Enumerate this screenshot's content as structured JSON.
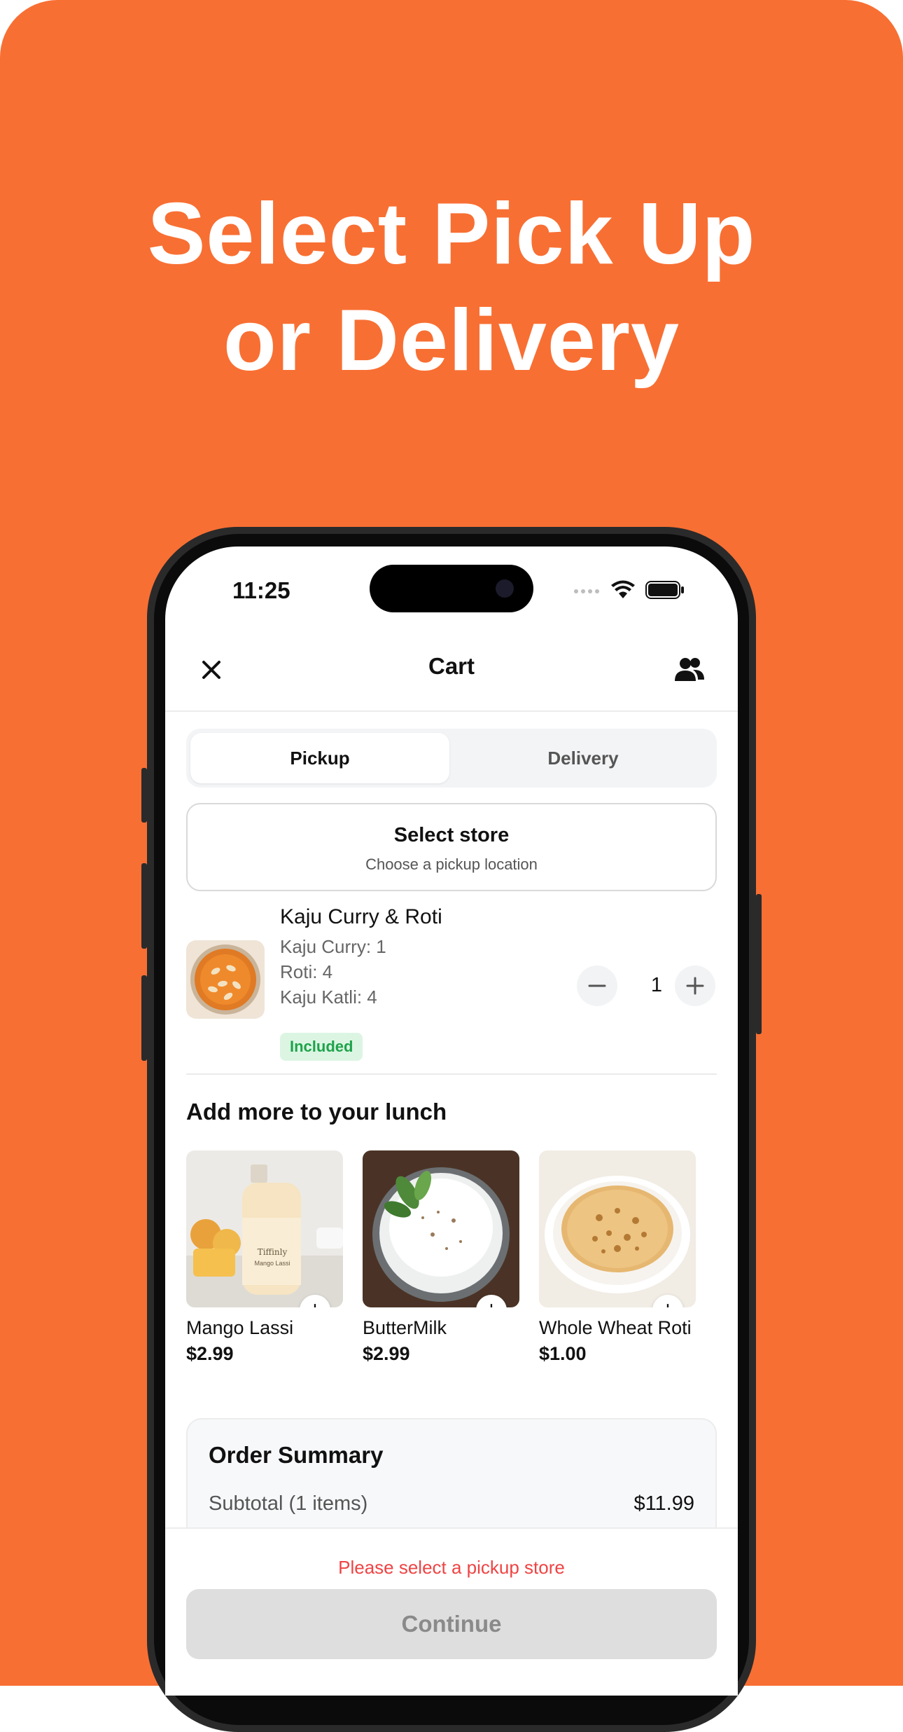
{
  "headline": {
    "line1": "Select Pick Up",
    "line2": "or Delivery"
  },
  "status_bar": {
    "time": "11:25"
  },
  "nav": {
    "title": "Cart"
  },
  "segmented": {
    "pickup": "Pickup",
    "delivery": "Delivery",
    "selected": "Pickup"
  },
  "store": {
    "title": "Select store",
    "subtitle": "Choose a pickup location"
  },
  "cart_item": {
    "title": "Kaju Curry & Roti",
    "lines": [
      "Kaju Curry: 1",
      "Roti: 4",
      "Kaju Katli: 4"
    ],
    "badge": "Included",
    "quantity": "1"
  },
  "add_more": {
    "title": "Add more to your lunch",
    "products": [
      {
        "name": "Mango Lassi",
        "price": "$2.99",
        "plus": "+"
      },
      {
        "name": "ButterMilk",
        "price": "$2.99",
        "plus": "+"
      },
      {
        "name": "Whole Wheat Roti",
        "price": "$1.00",
        "plus": "+"
      }
    ]
  },
  "summary": {
    "title": "Order Summary",
    "subtotal_label": "Subtotal (1 items)",
    "subtotal_value": "$11.99"
  },
  "footer": {
    "warning": "Please select a pickup store",
    "button": "Continue"
  },
  "colors": {
    "brand_orange": "#f86f33",
    "warning_red": "#ef4444",
    "badge_green": "#1fa34a"
  },
  "bottle_label": {
    "brand": "Tiffinly",
    "name": "Mango Lassi"
  }
}
